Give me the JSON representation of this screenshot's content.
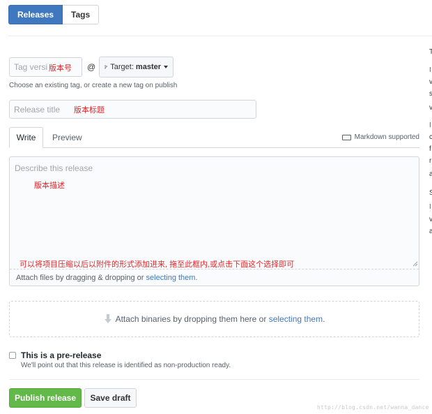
{
  "tabs": {
    "releases": "Releases",
    "tags": "Tags"
  },
  "tag": {
    "placeholder": "Tag versi",
    "annotation": "版本号",
    "at": "@",
    "target_label": "Target:",
    "target_value": "master",
    "note": "Choose an existing tag, or create a new tag on publish"
  },
  "title": {
    "placeholder": "Release title",
    "annotation": "版本标题"
  },
  "editor": {
    "write": "Write",
    "preview": "Preview",
    "markdown_note": "Markdown supported",
    "placeholder": "Describe this release",
    "desc_annotation": "版本描述",
    "attach_annotation": "可以将项目压缩以后以附件的形式添加进来, 拖至此框内,或点击下面这个选择即可",
    "attach_text": "Attach files by dragging & dropping or ",
    "attach_link": "selecting them",
    "attach_end": "."
  },
  "binaries": {
    "text": "Attach binaries by dropping them here or ",
    "link": "selecting them",
    "end": "."
  },
  "prerelease": {
    "label": "This is a pre-release",
    "note": "We'll point out that this release is identified as non-production ready."
  },
  "buttons": {
    "publish": "Publish release",
    "draft": "Save draft"
  },
  "sidebar_fragment": [
    "T",
    "I",
    "v",
    "s",
    "v",
    "I",
    "c",
    "f",
    "r",
    "a",
    "S",
    "I",
    "v",
    "a"
  ],
  "watermark": "http://blog.csdn.net/wanna_dance",
  "colors": {
    "accent": "#4078c0",
    "publish": "#63b84a",
    "annotation": "#e4262a"
  }
}
